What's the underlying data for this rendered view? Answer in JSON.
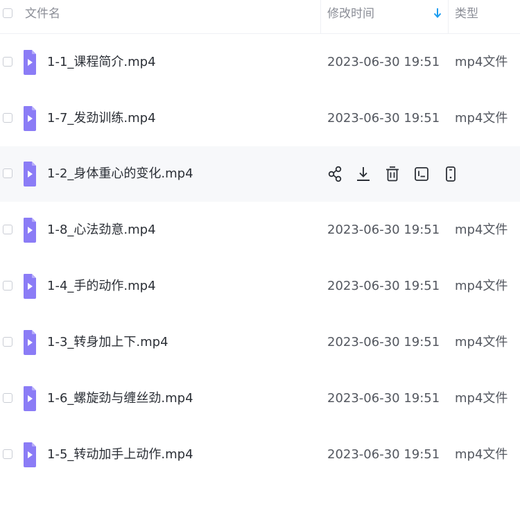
{
  "header": {
    "name_label": "文件名",
    "time_label": "修改时间",
    "type_label": "类型",
    "sort_icon": "arrow-down-icon"
  },
  "files": [
    {
      "name": "1-1_课程简介.mp4",
      "time": "2023-06-30 19:51",
      "type": "mp4文件"
    },
    {
      "name": "1-7_发劲训练.mp4",
      "time": "2023-06-30 19:51",
      "type": "mp4文件"
    },
    {
      "name": "1-2_身体重心的变化.mp4",
      "time": "",
      "type": ""
    },
    {
      "name": "1-8_心法劲意.mp4",
      "time": "2023-06-30 19:51",
      "type": "mp4文件"
    },
    {
      "name": "1-4_手的动作.mp4",
      "time": "2023-06-30 19:51",
      "type": "mp4文件"
    },
    {
      "name": "1-3_转身加上下.mp4",
      "time": "2023-06-30 19:51",
      "type": "mp4文件"
    },
    {
      "name": "1-6_螺旋劲与缠丝劲.mp4",
      "time": "2023-06-30 19:51",
      "type": "mp4文件"
    },
    {
      "name": "1-5_转动加手上动作.mp4",
      "time": "2023-06-30 19:51",
      "type": "mp4文件"
    }
  ],
  "hover_actions": [
    "share-icon",
    "download-icon",
    "delete-icon",
    "rename-icon",
    "more-icon"
  ],
  "colors": {
    "file_icon": "#8b7cf6",
    "sort_arrow": "#1a9cf0",
    "hover_row": "#f7f8fa"
  }
}
